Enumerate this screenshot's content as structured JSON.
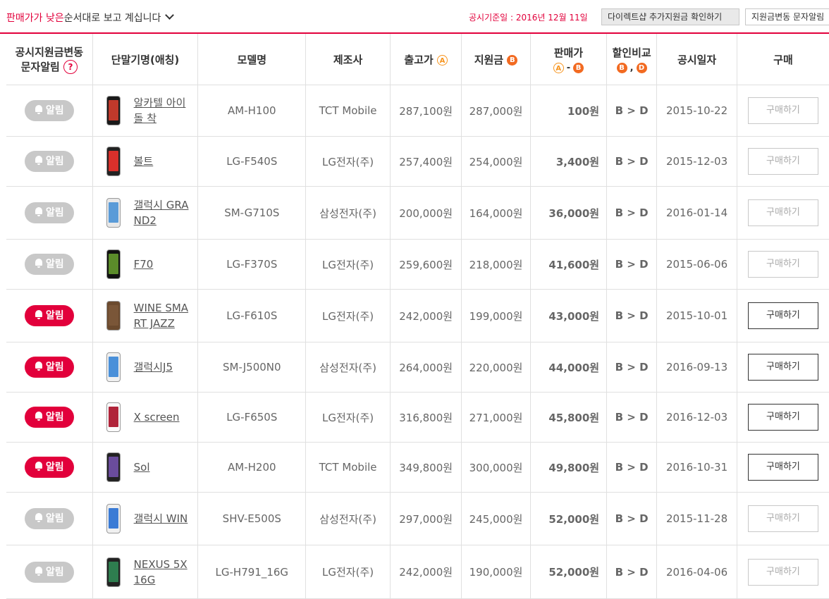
{
  "topbar": {
    "sort_highlight": "판매가가 낮은",
    "sort_rest": "순서대로 보고 계십니다",
    "pub_date": "공시기준일 : 2016년 12월 11일",
    "direct_button": "다이렉트샵 추가지원금 확인하기",
    "sms_button": "지원금변동 문자알림"
  },
  "headers": {
    "alarm_line1": "공시지원금변동",
    "alarm_line2": "문자알림",
    "help_icon": "?",
    "device": "단말기명(애칭)",
    "model": "모델명",
    "maker": "제조사",
    "factory_price": "출고가",
    "support": "지원금",
    "sale_price": "판매가",
    "discount": "할인비교",
    "pub_date": "공시일자",
    "buy": "구매",
    "circle_a": "A",
    "circle_b": "B",
    "circle_d": "D",
    "dash": "-",
    "comma": ","
  },
  "icons": {
    "bell": "bell-icon",
    "help": "question-circle-icon",
    "sort": "chevron-down-icon"
  },
  "colors": {
    "accent": "#e2003b",
    "orange": "#f26a21",
    "disabled": "#c8c8c8"
  },
  "rows": [
    {
      "alarm": "알림",
      "alarm_active": false,
      "name": "알카텔 아이돌 착",
      "model": "AM-H100",
      "maker": "TCT Mobile",
      "factory": "287,100원",
      "support": "287,000원",
      "sale": "100원",
      "compare": "B > D",
      "date": "2015-10-22",
      "buy": "구매하기",
      "buy_active": false,
      "phone_color": "#1a1a1a",
      "screen_color": "#c0392b"
    },
    {
      "alarm": "알림",
      "alarm_active": false,
      "name": "볼트",
      "model": "LG-F540S",
      "maker": "LG전자(주)",
      "factory": "257,400원",
      "support": "254,000원",
      "sale": "3,400원",
      "compare": "B > D",
      "date": "2015-12-03",
      "buy": "구매하기",
      "buy_active": false,
      "phone_color": "#222",
      "screen_color": "#d9302b"
    },
    {
      "alarm": "알림",
      "alarm_active": false,
      "name": "갤럭시 GRAND2",
      "model": "SM-G710S",
      "maker": "삼성전자(주)",
      "factory": "200,000원",
      "support": "164,000원",
      "sale": "36,000원",
      "compare": "B > D",
      "date": "2016-01-14",
      "buy": "구매하기",
      "buy_active": false,
      "phone_color": "#e8e8e8",
      "screen_color": "#5a9bd8"
    },
    {
      "alarm": "알림",
      "alarm_active": false,
      "name": "F70",
      "model": "LG-F370S",
      "maker": "LG전자(주)",
      "factory": "259,600원",
      "support": "218,000원",
      "sale": "41,600원",
      "compare": "B > D",
      "date": "2015-06-06",
      "buy": "구매하기",
      "buy_active": false,
      "phone_color": "#111",
      "screen_color": "#5b8c2a"
    },
    {
      "alarm": "알림",
      "alarm_active": true,
      "name": "WINE SMART JAZZ",
      "model": "LG-F610S",
      "maker": "LG전자(주)",
      "factory": "242,000원",
      "support": "199,000원",
      "sale": "43,000원",
      "compare": "B > D",
      "date": "2015-10-01",
      "buy": "구매하기",
      "buy_active": true,
      "phone_color": "#6b4a2e",
      "screen_color": "#7a5638"
    },
    {
      "alarm": "알림",
      "alarm_active": true,
      "name": "갤럭시J5",
      "model": "SM-J500N0",
      "maker": "삼성전자(주)",
      "factory": "264,000원",
      "support": "220,000원",
      "sale": "44,000원",
      "compare": "B > D",
      "date": "2016-09-13",
      "buy": "구매하기",
      "buy_active": true,
      "phone_color": "#f0f0f0",
      "screen_color": "#4a90d9"
    },
    {
      "alarm": "알림",
      "alarm_active": true,
      "name": "X screen",
      "model": "LG-F650S",
      "maker": "LG전자(주)",
      "factory": "316,800원",
      "support": "271,000원",
      "sale": "45,800원",
      "compare": "B > D",
      "date": "2016-12-03",
      "buy": "구매하기",
      "buy_active": true,
      "phone_color": "#fafafa",
      "screen_color": "#b0243a"
    },
    {
      "alarm": "알림",
      "alarm_active": true,
      "name": "Sol",
      "model": "AM-H200",
      "maker": "TCT Mobile",
      "factory": "349,800원",
      "support": "300,000원",
      "sale": "49,800원",
      "compare": "B > D",
      "date": "2016-10-31",
      "buy": "구매하기",
      "buy_active": true,
      "phone_color": "#222",
      "screen_color": "#6a4c9c"
    },
    {
      "alarm": "알림",
      "alarm_active": false,
      "name": "갤럭시 WIN",
      "model": "SHV-E500S",
      "maker": "삼성전자(주)",
      "factory": "297,000원",
      "support": "245,000원",
      "sale": "52,000원",
      "compare": "B > D",
      "date": "2015-11-28",
      "buy": "구매하기",
      "buy_active": false,
      "phone_color": "#f0f0f0",
      "screen_color": "#3a7bd5"
    },
    {
      "alarm": "알림",
      "alarm_active": false,
      "name": "NEXUS 5X 16G",
      "model": "LG-H791_16G",
      "maker": "LG전자(주)",
      "factory": "242,000원",
      "support": "190,000원",
      "sale": "52,000원",
      "compare": "B > D",
      "date": "2016-04-06",
      "buy": "구매하기",
      "buy_active": false,
      "phone_color": "#222",
      "screen_color": "#2e7d4f"
    }
  ]
}
